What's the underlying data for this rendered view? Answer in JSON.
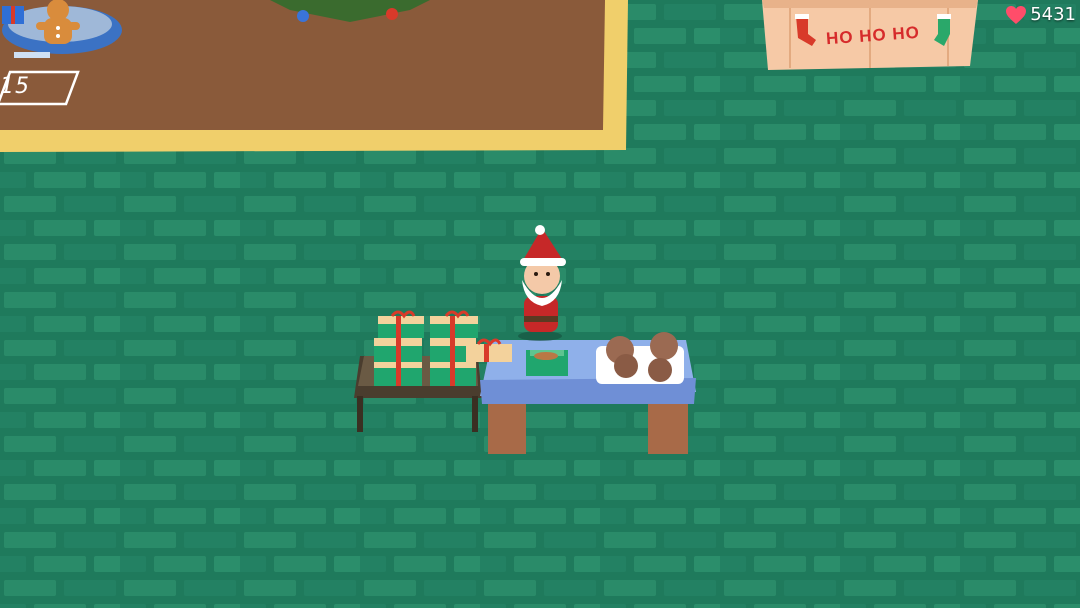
{
  "hud": {
    "hearts_value": "5431",
    "heart_icon": "heart-icon",
    "heart_color": "#ff4d6a"
  },
  "world": {
    "plate_number": "15",
    "sign_text": "HO HO HO"
  },
  "colors": {
    "floor": "#1f7a5c",
    "floor_brick": "#2a8b69",
    "dirt": "#8a5a3a",
    "border": "#f0cf6b",
    "santa_red": "#c62828",
    "table_blue": "#7d9fe0",
    "gift_green": "#20a66e",
    "gift_box": "#f3d29c",
    "ribbon": "#d83a2a"
  }
}
